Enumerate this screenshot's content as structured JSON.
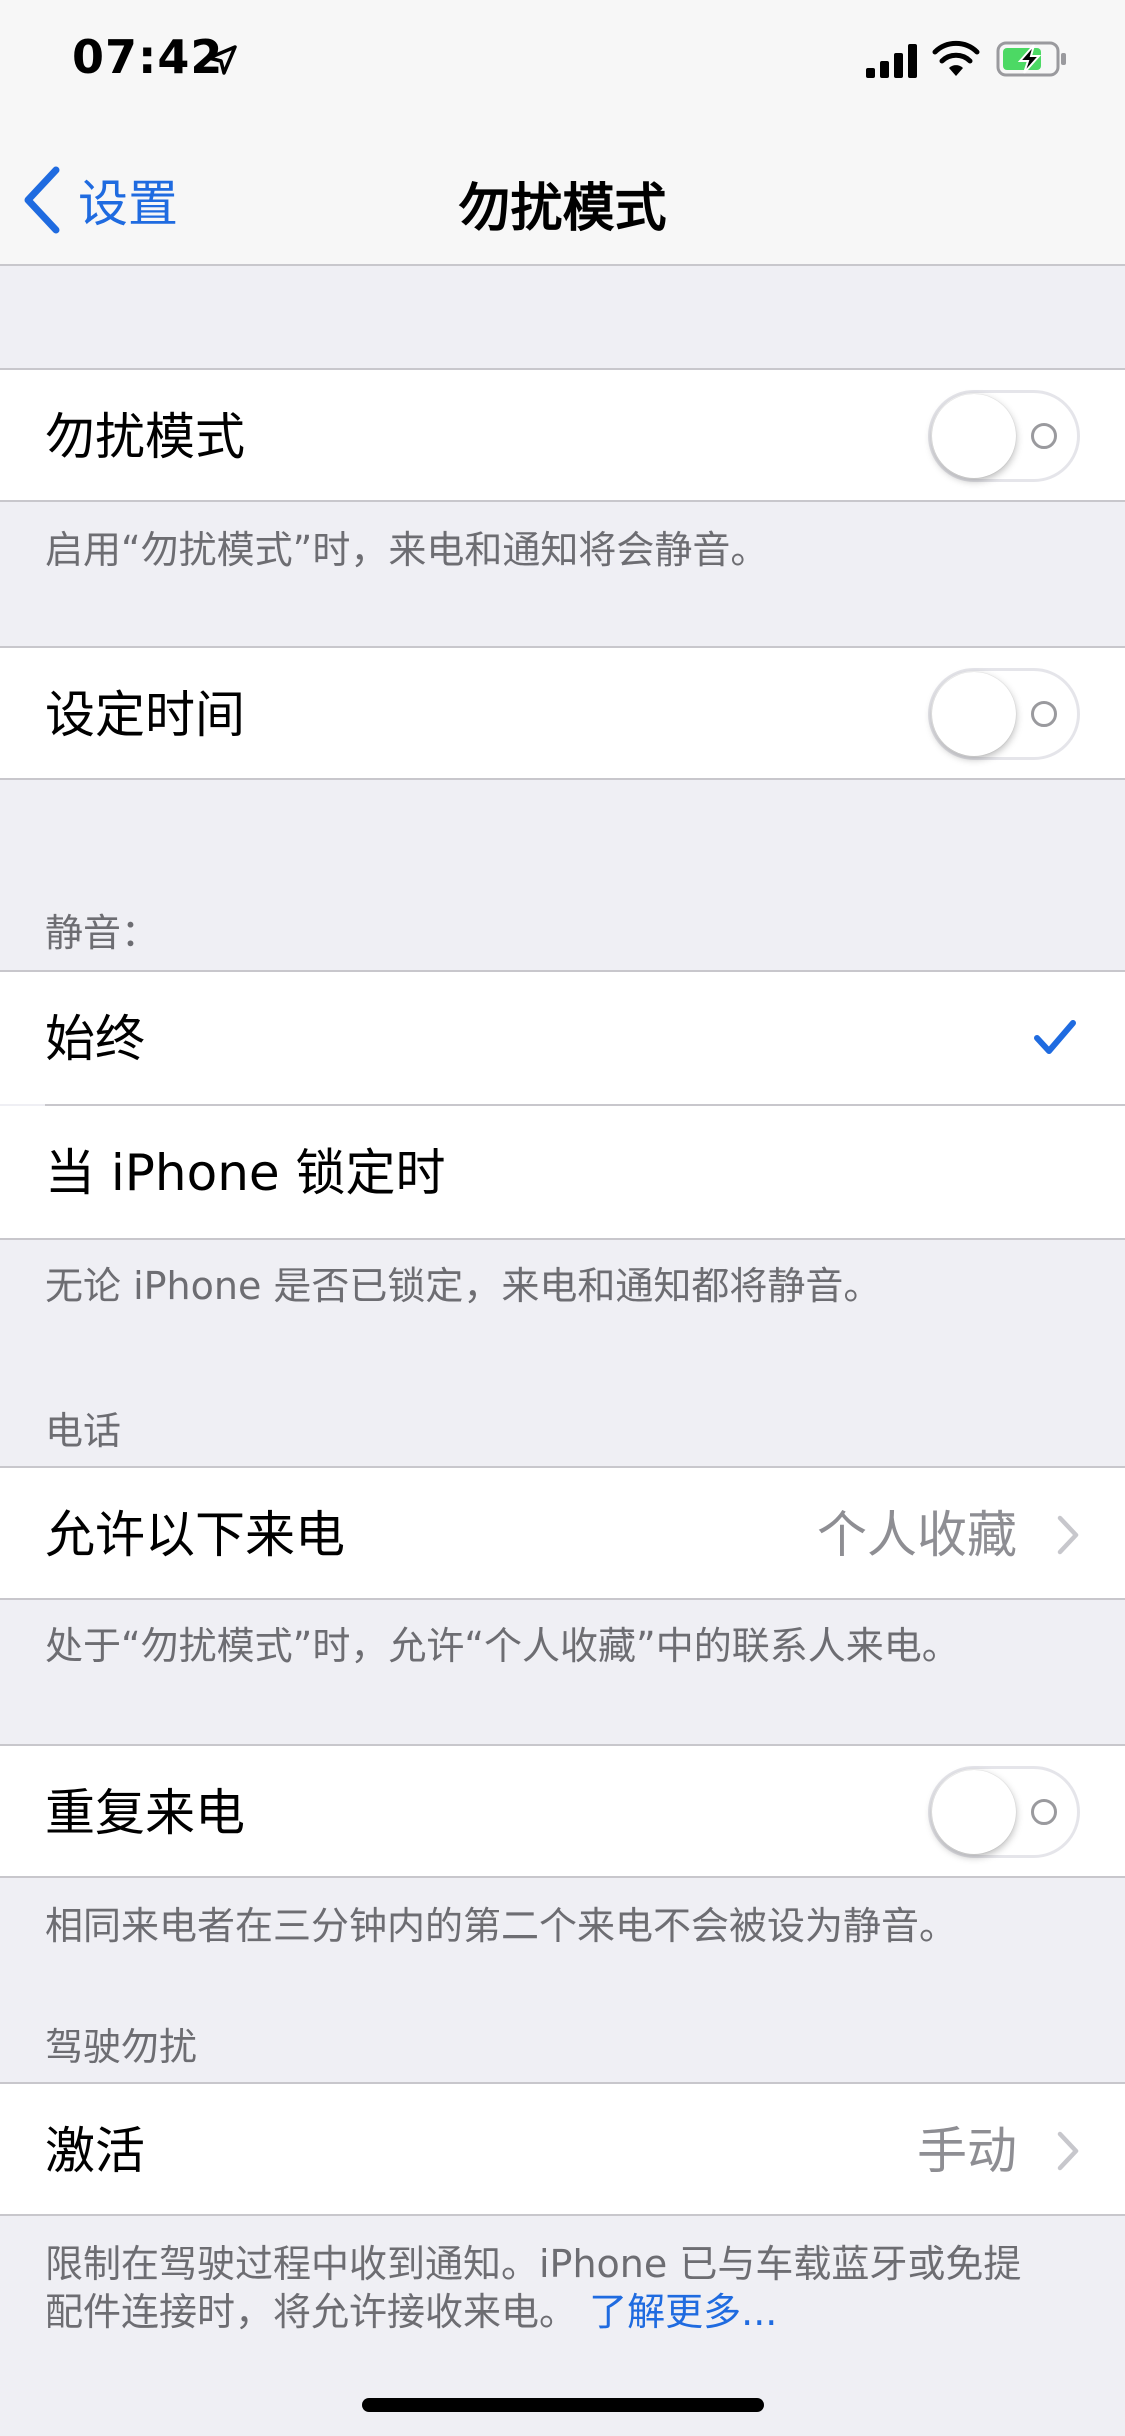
{
  "status_bar": {
    "time": "07:42",
    "icons": [
      "location-arrow-icon",
      "cellular-signal-icon",
      "wifi-icon",
      "battery-charging-icon"
    ]
  },
  "nav": {
    "back_label": "设置",
    "title": "勿扰模式"
  },
  "colors": {
    "accent": "#1f6be0",
    "background": "#efeff4",
    "secondary_text": "#6d6d72",
    "value_text": "#8e8e93",
    "separator": "#c8c7cc"
  },
  "dnd": {
    "label": "勿扰模式",
    "enabled": false,
    "footer": "启用“勿扰模式”时，来电和通知将会静音。"
  },
  "scheduled": {
    "label": "设定时间",
    "enabled": false
  },
  "silence": {
    "header": "静音：",
    "options": [
      {
        "label": "始终",
        "selected": true
      },
      {
        "label": "当 iPhone 锁定时",
        "selected": false
      }
    ],
    "footer": "无论 iPhone 是否已锁定，来电和通知都将静音。"
  },
  "phone": {
    "header": "电话",
    "allow_calls": {
      "label": "允许以下来电",
      "value": "个人收藏"
    },
    "footer": "处于“勿扰模式”时，允许“个人收藏”中的联系人来电。",
    "repeated_calls": {
      "label": "重复来电",
      "enabled": false
    },
    "repeated_footer": "相同来电者在三分钟内的第二个来电不会被设为静音。"
  },
  "driving": {
    "header": "驾驶勿扰",
    "activate": {
      "label": "激活",
      "value": "手动"
    },
    "footer_line1": "限制在驾驶过程中收到通知。iPhone 已与车载蓝牙或免提",
    "footer_line2": "配件连接时，将允许接收来电。",
    "learn_more": "了解更多..."
  }
}
